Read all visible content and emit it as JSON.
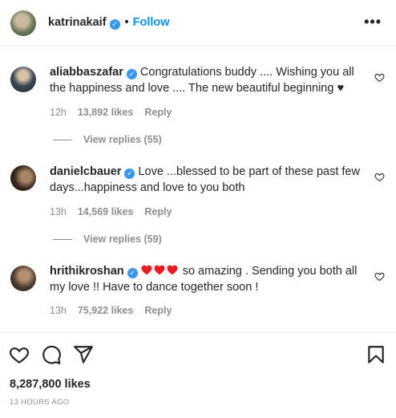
{
  "post": {
    "author": "katrinakaif",
    "follow_label": "Follow",
    "separator": "•",
    "more_label": "•••",
    "likes_total": "8,287,800 likes",
    "time_ago": "13 HOURS AGO"
  },
  "comments": [
    {
      "user": "aliabbaszafar",
      "text": "Congratulations buddy .... Wishing you all the happiness and love .... The new beautiful beginning ♥",
      "time": "12h",
      "likes": "13,892 likes",
      "reply": "Reply",
      "view_replies": "View replies (55)"
    },
    {
      "user": "danielcbauer",
      "text": "Love ...blessed to be part of these past few days...happiness and love to you both",
      "time": "13h",
      "likes": "14,569 likes",
      "reply": "Reply",
      "view_replies": "View replies (59)"
    },
    {
      "user": "hrithikroshan",
      "text": " so amazing . Sending you both all my love !! Have to dance together soon !",
      "time": "13h",
      "likes": "75,922 likes",
      "reply": "Reply"
    }
  ],
  "icons": {
    "verified": "verified-badge-icon",
    "like": "heart-outline-icon",
    "comment": "comment-bubble-icon",
    "share": "paper-plane-icon",
    "save": "bookmark-icon",
    "red_heart": "red-heart-emoji"
  },
  "colors": {
    "link_blue": "#0095f6",
    "verified_blue": "#3797f0",
    "muted": "#8e8e8e",
    "heart_red": "#ed1c24"
  }
}
